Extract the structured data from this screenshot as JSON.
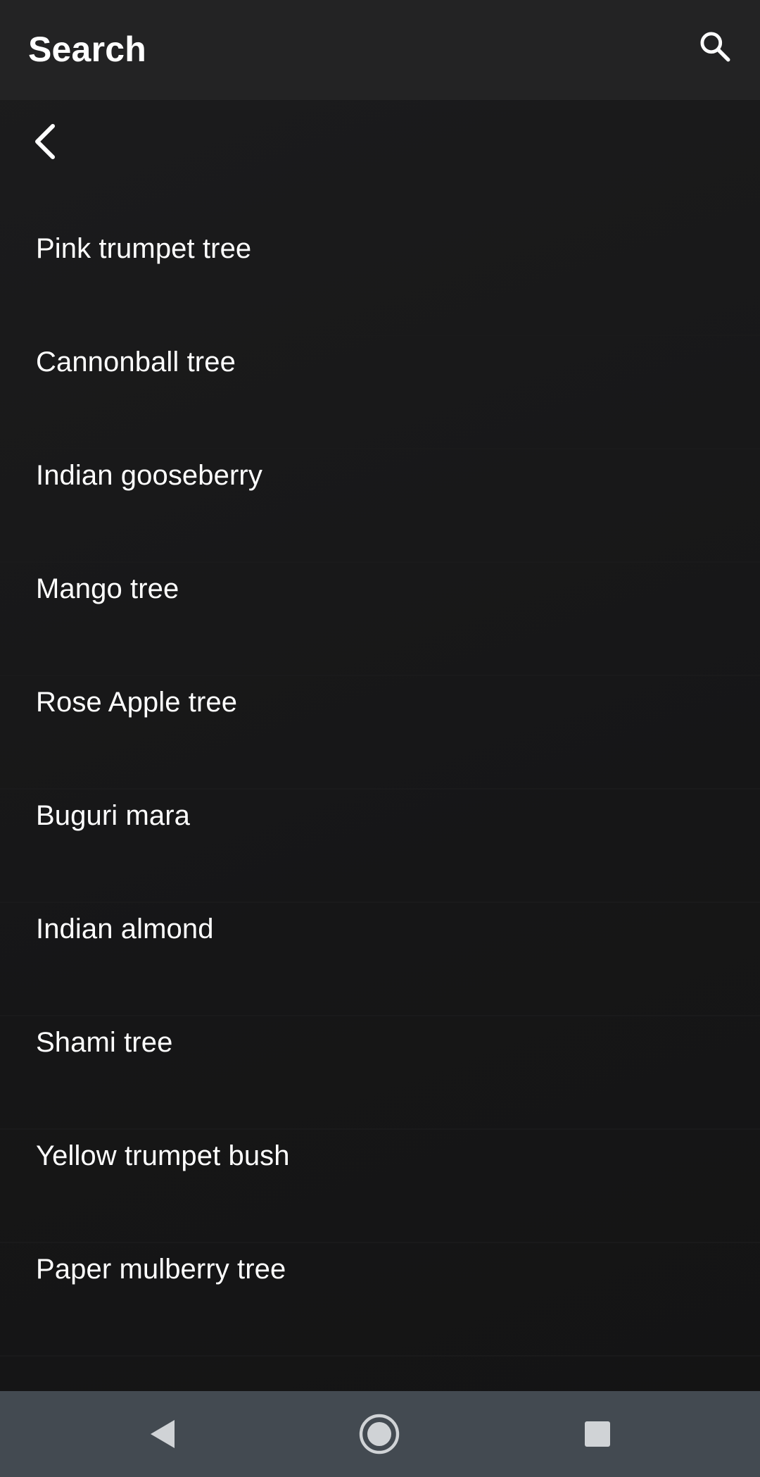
{
  "header": {
    "title": "Search",
    "search_icon": "search-icon"
  },
  "toolbar": {
    "back_icon": "chevron-left-icon"
  },
  "list": {
    "items": [
      {
        "label": "Pink trumpet tree"
      },
      {
        "label": "Cannonball tree"
      },
      {
        "label": "Indian gooseberry"
      },
      {
        "label": "Mango tree"
      },
      {
        "label": "Rose Apple tree"
      },
      {
        "label": "Buguri mara"
      },
      {
        "label": "Indian almond"
      },
      {
        "label": "Shami tree"
      },
      {
        "label": "Yellow trumpet bush"
      },
      {
        "label": "Paper mulberry tree"
      }
    ]
  },
  "system_nav": {
    "back_icon": "nav-back-triangle-icon",
    "home_icon": "nav-home-circle-icon",
    "recents_icon": "nav-recents-square-icon"
  },
  "colors": {
    "app_bar": "#232324",
    "background": "#161617",
    "text": "#ffffff",
    "nav_bar": "#434a51",
    "nav_icons": "#d0d3d6"
  }
}
